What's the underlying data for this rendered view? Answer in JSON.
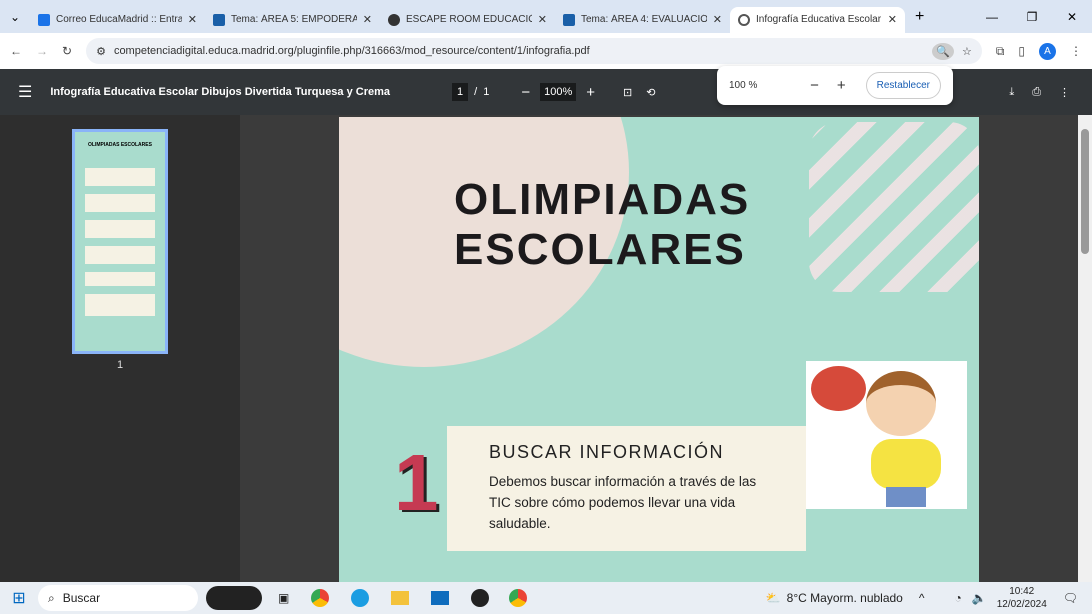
{
  "tabs": [
    {
      "label": "Correo EducaMadrid :: Entra",
      "color": "#1a73e8"
    },
    {
      "label": "Tema: ÁREA 5: EMPODERAM",
      "color": "#1a5fa8"
    },
    {
      "label": "ESCAPE ROOM EDUCACIÓN",
      "color": "#333"
    },
    {
      "label": "Tema: ÁREA 4: EVALUACIÓN",
      "color": "#1a5fa8"
    },
    {
      "label": "Infografía Educativa Escolar",
      "color": "#555"
    }
  ],
  "address": {
    "url": "competenciadigital.educa.madrid.org/pluginfile.php/316663/mod_resource/content/1/infografia.pdf",
    "profile": "A"
  },
  "pdf": {
    "title": "Infografía Educativa Escolar Dibujos Divertida Turquesa y Crema",
    "page": "1",
    "pages": "1",
    "zoom": "100%"
  },
  "zoom_popup": {
    "value": "100 %",
    "reset": "Restablecer"
  },
  "thumbnail": {
    "number": "1"
  },
  "document": {
    "title": "OLIMPIADAS ESCOLARES",
    "step_number": "1",
    "step_title": "BUSCAR INFORMACIÓN",
    "step_text": "Debemos buscar información a través de las TIC sobre cómo podemos llevar una vida saludable."
  },
  "taskbar": {
    "search": "Buscar",
    "weather": "8°C  Mayorm. nublado",
    "time": "10:42",
    "date": "12/02/2024"
  }
}
